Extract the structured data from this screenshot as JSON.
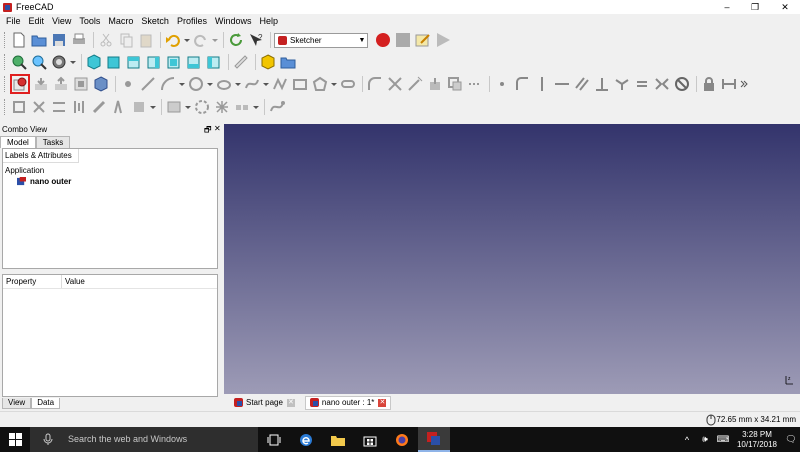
{
  "window": {
    "title": "FreeCAD",
    "controls": [
      "–",
      "❐",
      "✕"
    ]
  },
  "menu": [
    "File",
    "Edit",
    "View",
    "Tools",
    "Macro",
    "Sketch",
    "Profiles",
    "Windows",
    "Help"
  ],
  "workbench": {
    "selected": "Sketcher"
  },
  "combo_view": {
    "title": "Combo View",
    "tabs": [
      "Model",
      "Tasks"
    ],
    "tree_header": "Labels & Attributes",
    "tree_root": "Application",
    "tree_document": "nano outer",
    "property_columns": [
      "Property",
      "Value"
    ],
    "bottom_tabs": [
      "View",
      "Data"
    ]
  },
  "document_tabs": [
    {
      "label": "Start page",
      "active": false
    },
    {
      "label": "nano outer : 1*",
      "active": true
    }
  ],
  "status": {
    "dimensions": "72.65 mm x 34.21 mm"
  },
  "taskbar": {
    "search_placeholder": "Search the web and Windows",
    "time": "3:28 PM",
    "date": "10/17/2018"
  },
  "colors": {
    "viewport_top": "#33346c",
    "viewport_bottom": "#9d9bb6",
    "highlight_box": "#e02020",
    "freecad_red": "#c42020",
    "freecad_blue": "#2b4fa8"
  }
}
